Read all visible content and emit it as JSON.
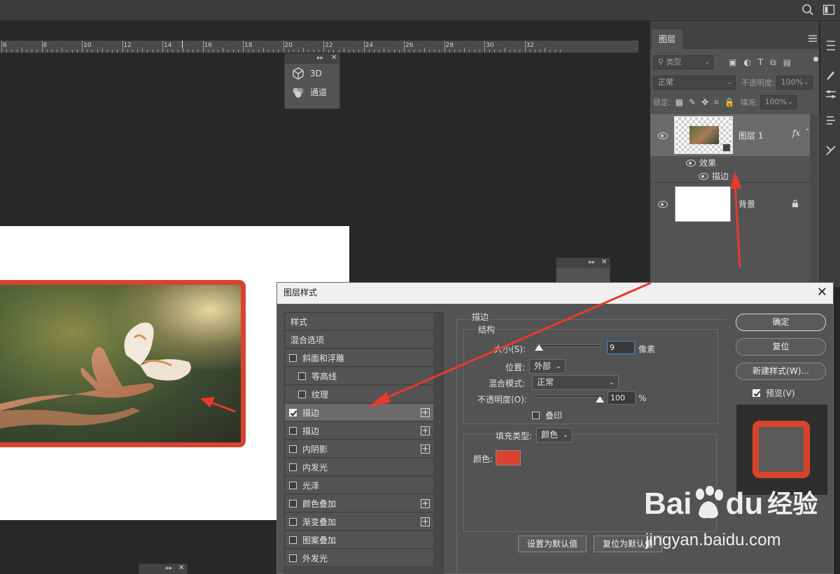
{
  "ruler": {
    "labels": [
      "6",
      "8",
      "10",
      "12",
      "14",
      "16",
      "18",
      "20",
      "22",
      "24",
      "26",
      "28",
      "30",
      "32"
    ]
  },
  "panels": {
    "mini1": {
      "items": [
        {
          "label": "3D",
          "icon": "cube-icon"
        },
        {
          "label": "通道",
          "icon": "channels-icon"
        }
      ]
    }
  },
  "layers_panel": {
    "tab_label": "图层",
    "filter_kind": "类型",
    "blend_mode": "正常",
    "opacity_label": "不透明度:",
    "opacity_value": "100%",
    "lock_label": "锁定:",
    "fill_label": "填充:",
    "fill_value": "100%",
    "layers": [
      {
        "name": "图层 1",
        "fx": "fx",
        "effects_label": "效果",
        "effect": "描边"
      },
      {
        "name": "背景"
      }
    ]
  },
  "dialog": {
    "title": "图层样式",
    "style_list": [
      {
        "label": "样式",
        "type": "header"
      },
      {
        "label": "混合选项",
        "type": "header"
      },
      {
        "label": "斜面和浮雕",
        "checked": false
      },
      {
        "label": "等高线",
        "checked": false,
        "indent": true
      },
      {
        "label": "纹理",
        "checked": false,
        "indent": true
      },
      {
        "label": "描边",
        "checked": true,
        "plus": true,
        "selected": true
      },
      {
        "label": "描边",
        "checked": false,
        "plus": true
      },
      {
        "label": "内阴影",
        "checked": false,
        "plus": true
      },
      {
        "label": "内发光",
        "checked": false
      },
      {
        "label": "光泽",
        "checked": false
      },
      {
        "label": "颜色叠加",
        "checked": false,
        "plus": true
      },
      {
        "label": "渐变叠加",
        "checked": false,
        "plus": true
      },
      {
        "label": "图案叠加",
        "checked": false
      },
      {
        "label": "外发光",
        "checked": false
      }
    ],
    "stroke": {
      "section_title": "描边",
      "structure_title": "结构",
      "size_label": "大小(S):",
      "size_value": "9",
      "size_unit": "像素",
      "position_label": "位置:",
      "position_value": "外部",
      "blend_label": "混合模式:",
      "blend_value": "正常",
      "opacity_label": "不透明度(O):",
      "opacity_value": "100",
      "opacity_unit": "%",
      "overprint_label": "叠印",
      "fill_type_label": "填充类型:",
      "fill_type_value": "颜色",
      "color_label": "颜色:",
      "color": "#d8432f",
      "set_default": "设置为默认值",
      "reset_default": "复位为默认值"
    },
    "buttons": {
      "ok": "确定",
      "reset": "复位",
      "new_style": "新建样式(W)..."
    },
    "preview_label": "预览(V)"
  },
  "watermark": {
    "brand": "Bai",
    "brand2": "du",
    "brand_cn": "经验",
    "url": "jingyan.baidu.com"
  },
  "colors": {
    "stroke_red": "#d8432f",
    "arrow_red": "#e8392d"
  }
}
